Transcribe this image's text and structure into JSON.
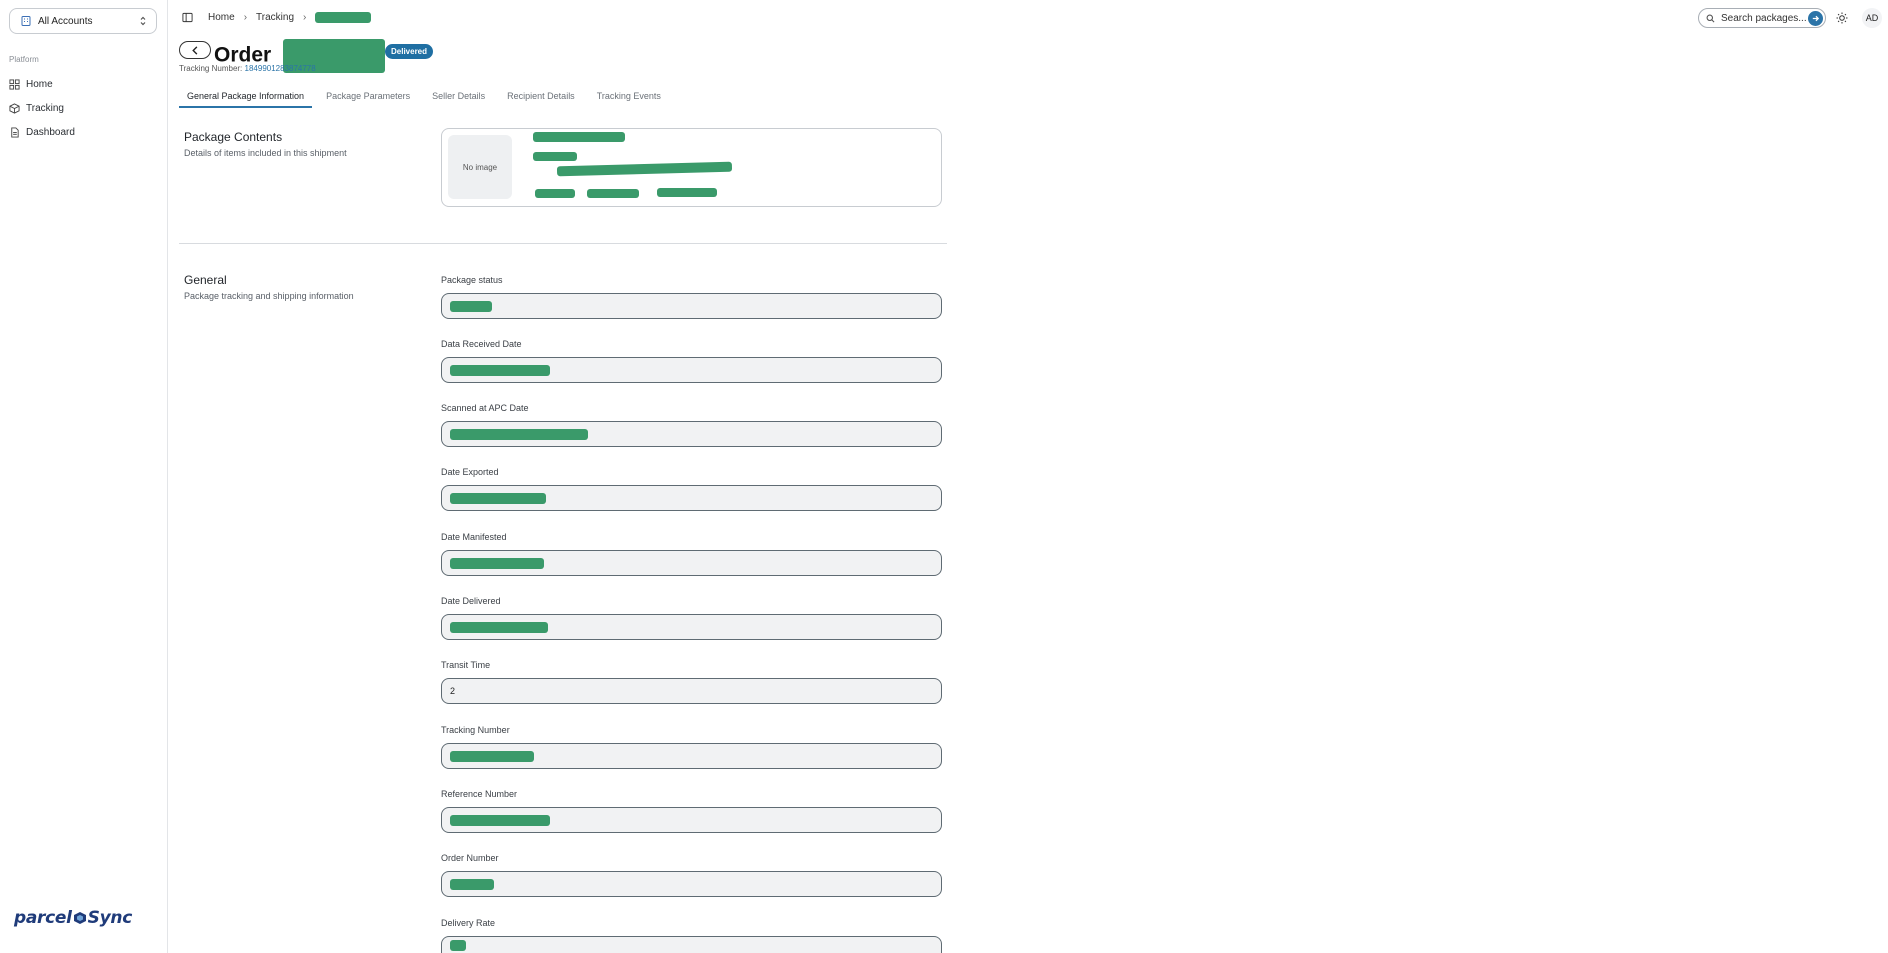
{
  "sidebar": {
    "account_select": "All Accounts",
    "section_label": "Platform",
    "items": [
      {
        "label": "Home",
        "icon": "grid-icon"
      },
      {
        "label": "Tracking",
        "icon": "package-icon"
      },
      {
        "label": "Dashboard",
        "icon": "document-icon"
      }
    ],
    "logo_text_left": "parcel",
    "logo_text_right": "Sync"
  },
  "topbar": {
    "breadcrumb": [
      "Home",
      "Tracking"
    ],
    "search_placeholder": "Search packages...",
    "avatar_initials": "AD"
  },
  "header": {
    "title": "Order",
    "status_badge": "Delivered",
    "tracking_label": "Tracking Number:",
    "tracking_value": "1849901283874778"
  },
  "tabs": [
    {
      "label": "General Package Information",
      "active": true
    },
    {
      "label": "Package Parameters",
      "active": false
    },
    {
      "label": "Seller Details",
      "active": false
    },
    {
      "label": "Recipient Details",
      "active": false
    },
    {
      "label": "Tracking Events",
      "active": false
    }
  ],
  "package_contents": {
    "title": "Package Contents",
    "subtitle": "Details of items included in this shipment",
    "no_image": "No image"
  },
  "general": {
    "title": "General",
    "subtitle": "Package tracking and shipping information",
    "fields": [
      {
        "label": "Package status",
        "value": ""
      },
      {
        "label": "Data Received Date",
        "value": ""
      },
      {
        "label": "Scanned at APC Date",
        "value": ""
      },
      {
        "label": "Date Exported",
        "value": ""
      },
      {
        "label": "Date Manifested",
        "value": ""
      },
      {
        "label": "Date Delivered",
        "value": ""
      },
      {
        "label": "Transit Time",
        "value": "2"
      },
      {
        "label": "Tracking Number",
        "value": ""
      },
      {
        "label": "Reference Number",
        "value": ""
      },
      {
        "label": "Order Number",
        "value": ""
      },
      {
        "label": "Delivery Rate",
        "value": ""
      }
    ]
  },
  "colors": {
    "accent": "#2b74a8",
    "badge": "#1f6fa3",
    "redaction": "#3a9a6a",
    "field_bg": "#f1f2f3"
  }
}
